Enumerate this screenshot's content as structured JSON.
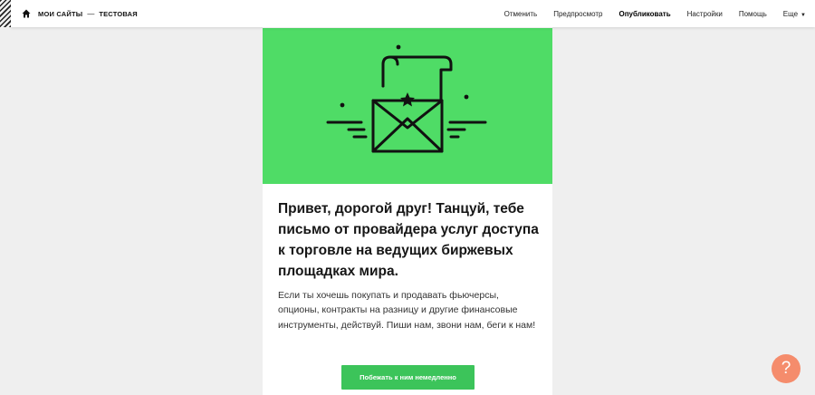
{
  "topbar": {
    "breadcrumb": {
      "root": "МОИ САЙТЫ",
      "separator": "—",
      "current": "ТЕСТОВАЯ"
    },
    "menu": [
      {
        "label": "Отменить"
      },
      {
        "label": "Предпросмотр"
      },
      {
        "label": "Опубликовать"
      },
      {
        "label": "Настройки"
      },
      {
        "label": "Помощь"
      },
      {
        "label": "Еще"
      }
    ]
  },
  "email": {
    "hero_icon": "envelope-letter-icon",
    "hero_color": "#4fdc66",
    "headline": "Привет, дорогой друг! Танцуй, тебе письмо от провайдера услуг доступа к торговле на ведущих биржевых площадках мира.",
    "body": "Если ты хочешь покупать и продавать фьючерсы, опционы, контракты на разницу и другие финансовые инструменты, действуй. Пиши нам, звони нам, беги к нам!",
    "cta_label": "Побежать к ним немедленно",
    "cta_color": "#3cc45a"
  },
  "help_button": {
    "icon": "question-icon",
    "label": "?",
    "color": "#f58c6c"
  }
}
